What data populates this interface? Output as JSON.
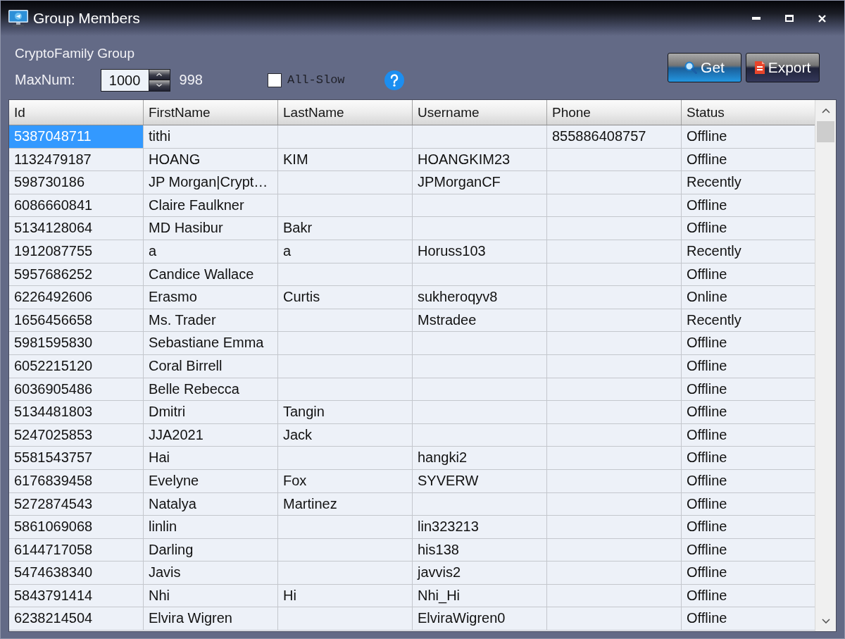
{
  "window": {
    "title": "Group Members"
  },
  "group": {
    "name": "CryptoFamily Group"
  },
  "max_num": {
    "label": "MaxNum:",
    "value": "1000",
    "count": "998"
  },
  "all_slow": {
    "label": "All-Slow",
    "checked": false
  },
  "buttons": [
    {
      "label": "Get",
      "kind": "get"
    },
    {
      "label": "Export",
      "kind": "export"
    }
  ],
  "table": {
    "columns": [
      "Id",
      "FirstName",
      "LastName",
      "Username",
      "Phone",
      "Status"
    ],
    "rows": [
      {
        "id": "5387048711",
        "first_name": "tithi",
        "phone": "855886408757",
        "status": "Offline",
        "selected": true
      },
      {
        "id": "1132479187",
        "first_name": "HOANG",
        "last_name": "KIM",
        "username": "HOANGKIM23",
        "status": "Offline",
        "selected": false
      },
      {
        "id": "598730186",
        "first_name": "JP Morgan|Crypt…",
        "username": "JPMorganCF",
        "status": "Recently",
        "selected": false
      },
      {
        "id": "6086660841",
        "first_name": "Claire Faulkner",
        "status": "Offline",
        "selected": false
      },
      {
        "id": "5134128064",
        "first_name": "MD Hasibur",
        "last_name": "Bakr",
        "status": "Offline",
        "selected": false
      },
      {
        "id": "1912087755",
        "first_name": "a",
        "last_name": "a",
        "username": "Horuss103",
        "status": "Recently",
        "selected": false
      },
      {
        "id": "5957686252",
        "first_name": "Candice Wallace",
        "status": "Offline",
        "selected": false
      },
      {
        "id": "6226492606",
        "first_name": "Erasmo",
        "last_name": "Curtis",
        "username": "sukheroqyv8",
        "status": "Online",
        "selected": false
      },
      {
        "id": "1656456658",
        "first_name": "Ms. Trader",
        "username": "Mstradee",
        "status": "Recently",
        "selected": false
      },
      {
        "id": "5981595830",
        "first_name": "Sebastiane Emma",
        "status": "Offline",
        "selected": false
      },
      {
        "id": "6052215120",
        "first_name": "Coral Birrell",
        "status": "Offline",
        "selected": false
      },
      {
        "id": "6036905486",
        "first_name": "Belle Rebecca",
        "status": "Offline",
        "selected": false
      },
      {
        "id": "5134481803",
        "first_name": "Dmitri",
        "last_name": "Tangin",
        "status": "Offline",
        "selected": false
      },
      {
        "id": "5247025853",
        "first_name": "JJA2021",
        "last_name": "Jack",
        "status": "Offline",
        "selected": false
      },
      {
        "id": "5581543757",
        "first_name": "Hai",
        "username": "hangki2",
        "status": "Offline",
        "selected": false
      },
      {
        "id": "6176839458",
        "first_name": "Evelyne",
        "last_name": "Fox",
        "username": "SYVERW",
        "status": "Offline",
        "selected": false
      },
      {
        "id": "5272874543",
        "first_name": "Natalya",
        "last_name": "Martinez",
        "status": "Offline",
        "selected": false
      },
      {
        "id": "5861069068",
        "first_name": "linlin",
        "username": "lin323213",
        "status": "Offline",
        "selected": false
      },
      {
        "id": "6144717058",
        "first_name": "Darling",
        "username": "his138",
        "status": "Offline",
        "selected": false
      },
      {
        "id": "5474638340",
        "first_name": "Javis",
        "username": "javvis2",
        "status": "Offline",
        "selected": false
      },
      {
        "id": "5843791414",
        "first_name": "Nhi",
        "last_name": "Hi",
        "username": "Nhi_Hi",
        "status": "Offline",
        "selected": false
      },
      {
        "id": "6238214504",
        "first_name": "Elvira Wigren",
        "username": "ElviraWigren0",
        "status": "Offline",
        "selected": false
      }
    ]
  }
}
